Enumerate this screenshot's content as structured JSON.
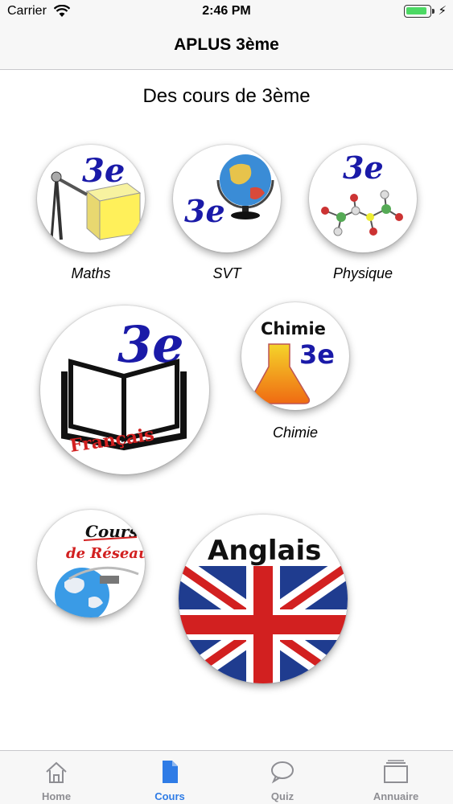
{
  "status_bar": {
    "carrier": "Carrier",
    "time": "2:46 PM",
    "battery_level": 0.9
  },
  "nav": {
    "title": "APLUS 3ème"
  },
  "heading": "Des cours de 3ème",
  "courses": [
    {
      "label": "Maths",
      "badge": "3e"
    },
    {
      "label": "SVT",
      "badge": "3e"
    },
    {
      "label": "Physique",
      "badge": "3e"
    },
    {
      "label": "",
      "badge": "3e",
      "image_text": "Français"
    },
    {
      "label": "Chimie",
      "badge": "3e",
      "image_text": "Chimie"
    },
    {
      "label": "",
      "image_text": [
        "Cours",
        "de Réseau"
      ]
    },
    {
      "label": "",
      "image_text": "Anglais"
    }
  ],
  "tab_bar": {
    "tabs": [
      {
        "label": "Home",
        "icon": "home-icon",
        "active": false
      },
      {
        "label": "Cours",
        "icon": "document-icon",
        "active": true
      },
      {
        "label": "Quiz",
        "icon": "chat-bubble-icon",
        "active": false
      },
      {
        "label": "Annuaire",
        "icon": "directory-icon",
        "active": false
      }
    ]
  },
  "colors": {
    "accent": "#2f7ce6",
    "inactive": "#8e8e93",
    "badge_blue": "#1a1aa8",
    "red": "#d22020"
  }
}
